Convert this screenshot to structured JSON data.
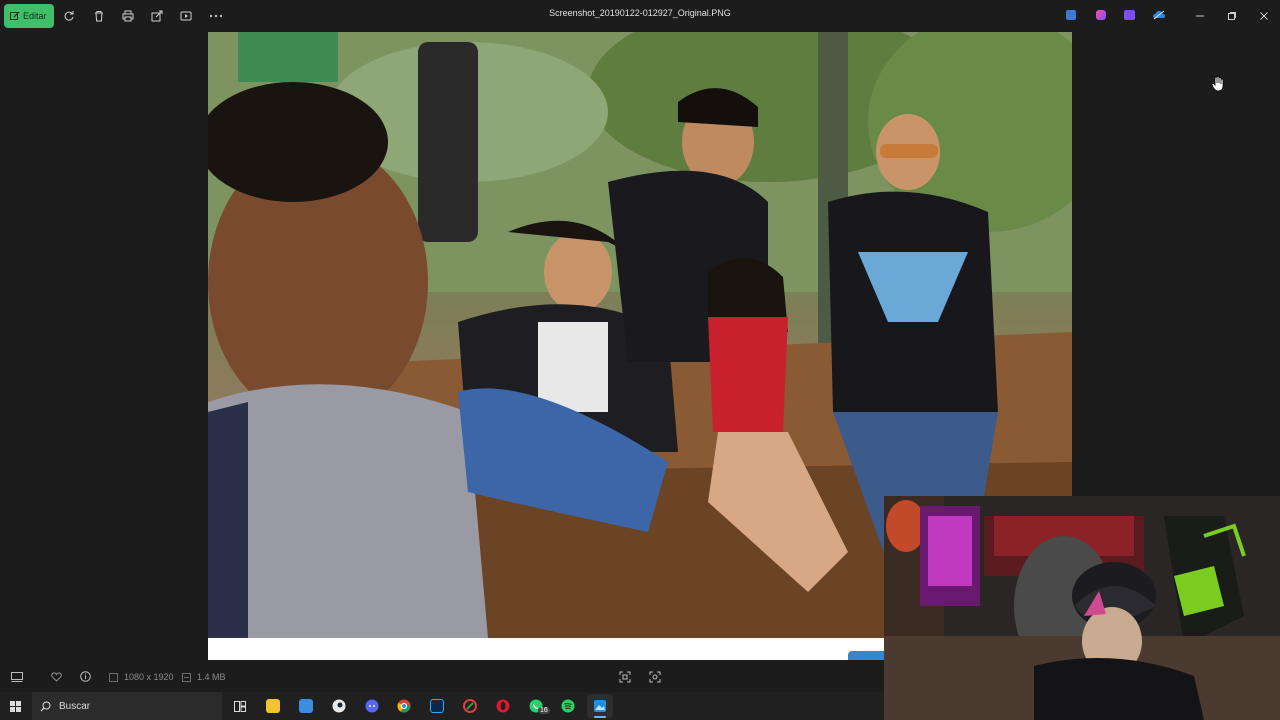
{
  "toolbar": {
    "edit_label": "Editar",
    "icons": [
      "rotate-icon",
      "trash-icon",
      "print-icon",
      "share-icon",
      "slideshow-icon",
      "more-icon"
    ]
  },
  "window": {
    "title": "Screenshot_20190122-012927_Original.PNG",
    "controls": [
      "minimize-icon",
      "restore-icon",
      "close-icon"
    ]
  },
  "info": {
    "dimensions": "1080 x 1920",
    "filesize": "1.4 MB"
  },
  "taskbar": {
    "search_placeholder": "Buscar",
    "apps": [
      {
        "name": "task-view",
        "color": "#dadada"
      },
      {
        "name": "file-explorer",
        "color": "#f2c230"
      },
      {
        "name": "store",
        "color": "#3b8de0"
      },
      {
        "name": "steam",
        "color": "#1b2838"
      },
      {
        "name": "discord",
        "color": "#5865f2"
      },
      {
        "name": "chrome",
        "color": "#e2a416"
      },
      {
        "name": "photoshop",
        "color": "#0b2a4a"
      },
      {
        "name": "app-red",
        "color": "#e23b3b"
      },
      {
        "name": "opera",
        "color": "#e0182d"
      },
      {
        "name": "whatsapp",
        "color": "#25d366"
      },
      {
        "name": "spotify",
        "color": "#1ed760"
      },
      {
        "name": "photos",
        "color": "#1f8fe0"
      }
    ],
    "whatsapp_badge": "16"
  },
  "colors": {
    "accent_green": "#3fbf6a",
    "background": "#1c1c1c",
    "taskbar": "#202020"
  }
}
